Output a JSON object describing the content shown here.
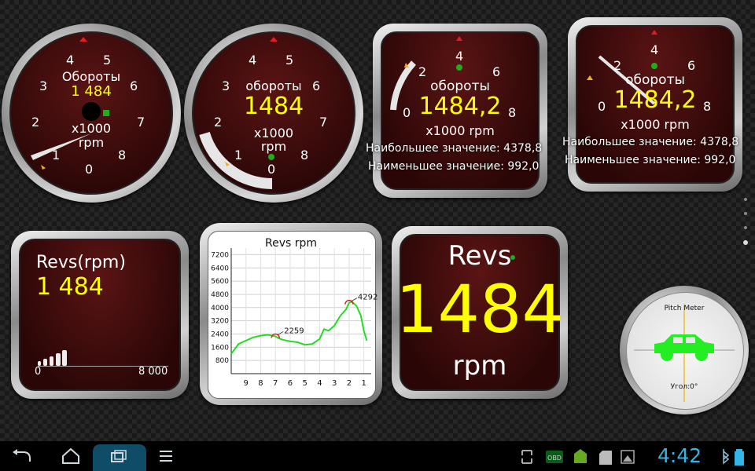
{
  "gauges": {
    "g1": {
      "label": "Обороты",
      "value": "1 484",
      "unit1": "x1000",
      "unit2": "rpm",
      "ticks": [
        "0",
        "1",
        "2",
        "3",
        "4",
        "5",
        "6",
        "7",
        "8"
      ]
    },
    "g2": {
      "label": "обороты",
      "value": "1484",
      "unit1": "x1000",
      "unit2": "rpm",
      "ticks": [
        "0",
        "1",
        "2",
        "3",
        "4",
        "5",
        "6",
        "7",
        "8"
      ]
    },
    "g3": {
      "label": "обороты",
      "value": "1484,2",
      "unit": "x1000 rpm",
      "max_label": "Наибольшее значение: 4378,8",
      "min_label": "Наименьшее значение: 992,0",
      "ticks": [
        "0",
        "2",
        "4",
        "6",
        "8"
      ]
    },
    "g4": {
      "label": "обороты",
      "value": "1484,2",
      "unit": "x1000 rpm",
      "max_label": "Наибольшее значение: 4378,8",
      "min_label": "Наименьшее значение: 992,0",
      "ticks": [
        "0",
        "2",
        "4",
        "6",
        "8"
      ]
    }
  },
  "bar_widget": {
    "label": "Revs(rpm)",
    "value": "1 484",
    "scale_min": "0",
    "scale_max": "8 000",
    "level_fraction": 0.19
  },
  "graph_widget": {
    "title": "Revs rpm",
    "annotations": [
      "2259",
      "4292"
    ],
    "chart_data": {
      "type": "line",
      "title": "Revs rpm",
      "x": [
        10,
        9.5,
        9,
        8.5,
        8,
        7.5,
        7,
        6.8,
        6.5,
        6,
        5.5,
        5,
        4.5,
        4,
        3.7,
        3.4,
        3,
        2.6,
        2.2,
        2,
        1.8,
        1.5,
        1.2,
        1,
        0.8
      ],
      "y": [
        1200,
        1800,
        2000,
        2200,
        2300,
        2350,
        2259,
        2150,
        2050,
        1950,
        1900,
        1750,
        1800,
        2100,
        2700,
        2600,
        2900,
        3500,
        3900,
        4292,
        4350,
        4100,
        3500,
        2600,
        2000
      ],
      "x_ticks": [
        "9",
        "8",
        "7",
        "6",
        "5",
        "4",
        "3",
        "2",
        "1"
      ],
      "y_ticks": [
        "800",
        "1600",
        "2400",
        "3200",
        "4000",
        "4800",
        "5600",
        "6400",
        "7200"
      ],
      "ylim": [
        0,
        7600
      ],
      "xlim": [
        10,
        0.5
      ],
      "grid": true
    }
  },
  "digital_widget": {
    "label": "Revs",
    "value": "1484",
    "unit": "rpm"
  },
  "pitch_meter": {
    "title": "Pitch Meter",
    "angle_label": "Угол:0°"
  },
  "navbar": {
    "time": "4:42"
  },
  "colors": {
    "needle_value": "#ffff00",
    "text": "#ffffff",
    "face": "#3a0a0a",
    "graph_line": "#22dd22",
    "car": "#22ee22",
    "accent_red": "#e02020"
  }
}
